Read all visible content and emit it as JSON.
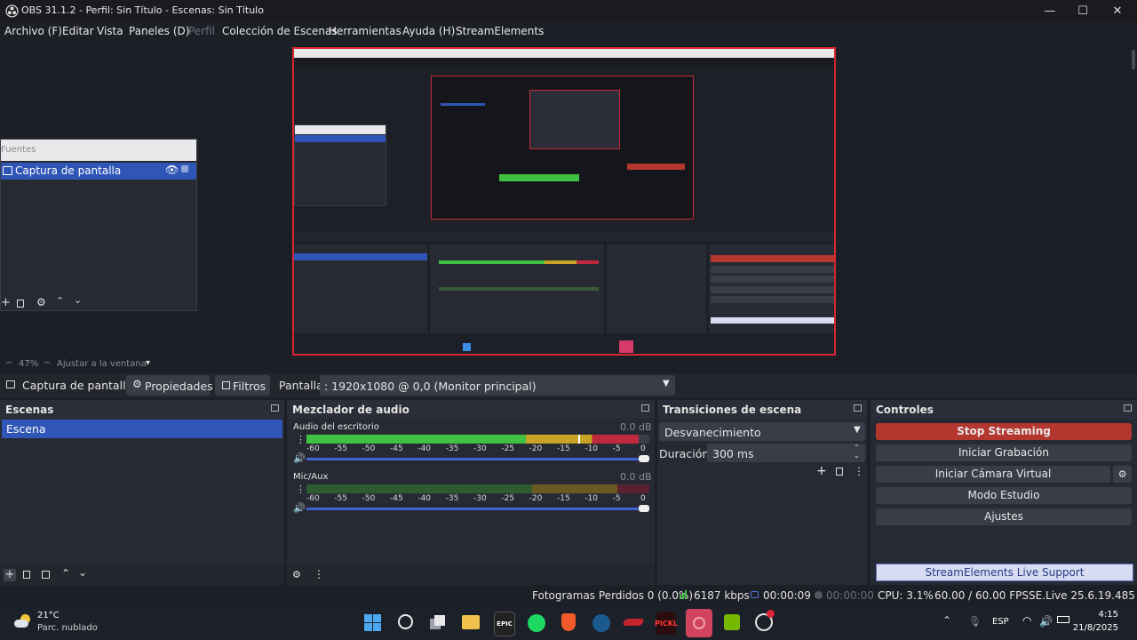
{
  "window": {
    "title": "OBS 31.1.2 - Perfil: Sin Título - Escenas: Sin Título",
    "minimize": "—",
    "maximize": "☐",
    "close": "✕"
  },
  "menu": [
    "Archivo (F)",
    "Editar",
    "Vista",
    "Paneles (D)",
    "Perfil",
    "Colección de Escenas",
    "Herramientas",
    "Ayuda (H)",
    "StreamElements"
  ],
  "floating_sources": {
    "title": "Fuentes",
    "item_label": "Captura de pantalla"
  },
  "zoom": {
    "zoom_label": "47%",
    "fit_label": "Ajustar a la ventana"
  },
  "source_bar": {
    "source_name": "Captura de pantalla",
    "properties_label": "Propiedades",
    "filters_label": "Filtros",
    "display_label": "Pantalla",
    "display_value": ": 1920x1080 @ 0,0 (Monitor principal)"
  },
  "scenes": {
    "title": "Escenas",
    "items": [
      "Escena"
    ]
  },
  "mixer": {
    "title": "Mezclador de audio",
    "ticks": [
      "-60",
      "-55",
      "-50",
      "-45",
      "-40",
      "-35",
      "-30",
      "-25",
      "-20",
      "-15",
      "-10",
      "-5",
      "0"
    ],
    "channels": [
      {
        "name": "Audio del escritorio",
        "db": "0.0 dB",
        "level": 0.97
      },
      {
        "name": "Mic/Aux",
        "db": "0.0 dB",
        "level": 0.0
      }
    ]
  },
  "transitions": {
    "title": "Transiciones de escena",
    "selected": "Desvanecimiento",
    "duration_label": "Duración",
    "duration_value": "300 ms"
  },
  "controls": {
    "title": "Controles",
    "stop_streaming": "Stop Streaming",
    "start_recording": "Iniciar Grabación",
    "start_virtual_cam": "Iniciar Cámara Virtual",
    "studio_mode": "Modo Estudio",
    "settings": "Ajustes",
    "support": "StreamElements Live Support"
  },
  "status": {
    "dropped_frames": "Fotogramas Perdidos 0 (0.0%)",
    "bitrate": "6187 kbps",
    "stream_time": "00:00:09",
    "rec_time": "00:00:00",
    "cpu": "CPU: 3.1%",
    "fps": "60.00 / 60.00 FPS",
    "se_version": "SE.Live 25.6.19.485"
  },
  "taskbar": {
    "weather_temp": "21°C",
    "weather_desc": "Parc. nublado",
    "language": "ESP",
    "time": "4:15",
    "date": "21/8/2025",
    "epic_label": "EPIC",
    "pickle_label": "PICKL"
  },
  "colors": {
    "accent_blue": "#2f56b6",
    "stop_red": "#b3372e",
    "meter_green": "#41c141",
    "meter_yellow": "#c9a324",
    "meter_red": "#c0283d",
    "support_bg": "#d7dcf2"
  }
}
